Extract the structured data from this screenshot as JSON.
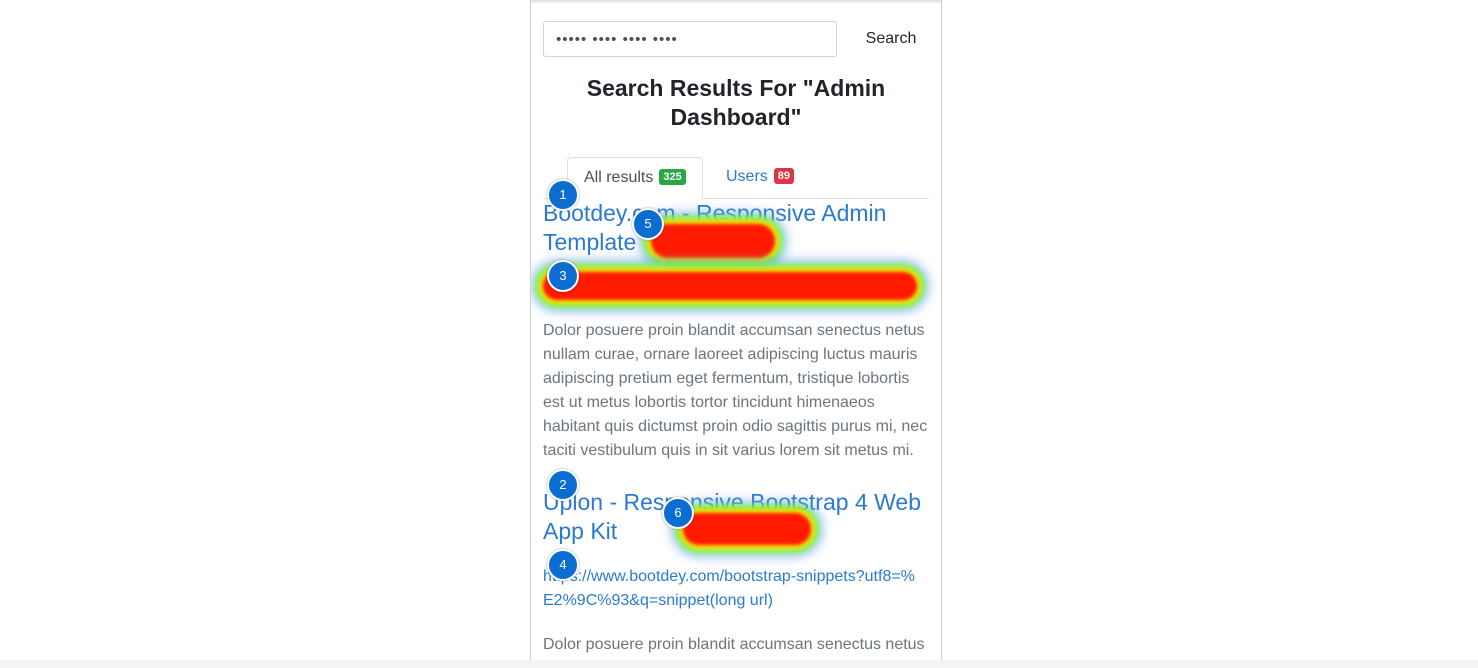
{
  "search": {
    "value": "••••• •••• •••• ••••",
    "button_label": "Search"
  },
  "page_title": "Search Results For \"Admin Dashboard\"",
  "tabs": [
    {
      "label": "All results",
      "count": "325",
      "count_color": "#28a745",
      "active": true
    },
    {
      "label": "Users",
      "count": "89",
      "count_color": "#dc3545",
      "active": false
    }
  ],
  "results": [
    {
      "title": "Bootdey.com - Responsive Admin Template",
      "description": "Dolor posuere proin blandit accumsan senectus netus nullam curae, ornare laoreet adipiscing luctus mauris adipiscing pretium eget fermentum, tristique lobortis est ut metus lobortis tortor tincidunt himenaeos habitant quis dictumst proin odio sagittis purus mi, nec taciti vestibulum quis in sit varius lorem sit metus mi."
    },
    {
      "title": "Uplon - Responsive Bootstrap 4 Web App Kit",
      "url": "https://www.bootdey.com/bootstrap-snippets?utf8=%E2%9C%93&q=snippet(long url)",
      "description": "Dolor posuere proin blandit accumsan senectus netus nullam curae, ornare laoreet adipiscing luctus mauris"
    }
  ],
  "markers": [
    "1",
    "2",
    "3",
    "4",
    "5",
    "6"
  ],
  "colors": {
    "link": "#2b7ad1",
    "marker": "#0c6dd0",
    "heat_core": "#ff1a00"
  }
}
